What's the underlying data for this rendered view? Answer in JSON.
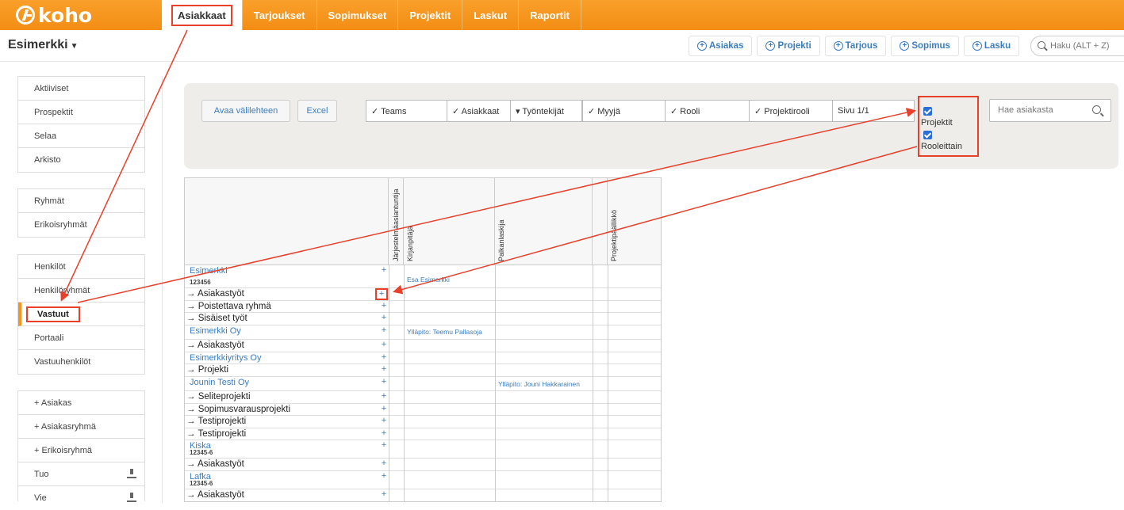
{
  "logo": {
    "text": "koho"
  },
  "topnav": [
    "Asiakkaat",
    "Tarjoukset",
    "Sopimukset",
    "Projektit",
    "Laskut",
    "Raportit"
  ],
  "org": {
    "name": "Esimerkki"
  },
  "quick": [
    "Asiakas",
    "Projekti",
    "Tarjous",
    "Sopimus",
    "Lasku"
  ],
  "search": {
    "placeholder": "Haku (ALT + Z)"
  },
  "sidebar": {
    "group1": [
      "Aktiiviset",
      "Prospektit",
      "Selaa",
      "Arkisto"
    ],
    "group2": [
      "Ryhmät",
      "Erikoisryhmät"
    ],
    "group3": [
      "Henkilöt",
      "Henkilöryhmät",
      "Vastuut",
      "Portaali",
      "Vastuuhenkilöt"
    ],
    "group4": [
      "+ Asiakas",
      "+ Asiakasryhmä",
      "+ Erikoisryhmä",
      "Tuo",
      "Vie"
    ]
  },
  "filters": {
    "open_tab": "Avaa välilehteen",
    "excel": "Excel",
    "teams": "✓ Teams",
    "customers": "✓ Asiakkaat",
    "employees": "▾ Työntekijät",
    "seller": "✓ Myyjä",
    "role": "✓ Rooli",
    "project_role": "✓ Projektirooli",
    "page": "Sivu 1/1",
    "chk_projects": "Projektit",
    "chk_byrole": "Rooleittain",
    "cust_search": "Hae asiakasta"
  },
  "columns": [
    "Järjestelmäasiantuntija",
    "Kirjanpitäjä",
    "Palkanlaskija",
    "Projektipäällikkö"
  ],
  "rows": [
    {
      "name": "Esimerkki",
      "code": "123456",
      "plus": "+",
      "kirjanpitaja": "Esa Esimerkki"
    },
    {
      "name": "→ Asiakastyöt",
      "plus": "+"
    },
    {
      "name": "→ Poistettava ryhmä",
      "plus": "+"
    },
    {
      "name": "→ Sisäiset työt",
      "plus": "+"
    },
    {
      "name": "Esimerkki Oy",
      "plus": "+",
      "kirjanpitaja": "Ylläpito: Teemu Pallasoja"
    },
    {
      "name": "→ Asiakastyöt",
      "plus": "+"
    },
    {
      "name": "Esimerkkiyritys Oy",
      "plus": "+"
    },
    {
      "name": "→ Projekti",
      "plus": "+"
    },
    {
      "name": "Jounin Testi Oy",
      "plus": "+",
      "palkanlaskija": "Ylläpito: Jouni Hakkarainen"
    },
    {
      "name": "→ Seliteprojekti",
      "plus": "+"
    },
    {
      "name": "→ Sopimusvarausprojekti",
      "plus": "+"
    },
    {
      "name": "→ Testiprojekti",
      "plus": "+"
    },
    {
      "name": "→ Testiprojekti",
      "plus": "+"
    },
    {
      "name": "Kiska",
      "code": "12345-6",
      "plus": "+"
    },
    {
      "name": "→ Asiakastyöt",
      "plus": "+"
    },
    {
      "name": "Lafka",
      "code": "12345-6",
      "plus": "+"
    },
    {
      "name": "→ Asiakastyöt",
      "plus": "+"
    }
  ],
  "colors": {
    "brand": "#f7941e",
    "link": "#3b7dc0",
    "annotation": "#e8402a"
  }
}
